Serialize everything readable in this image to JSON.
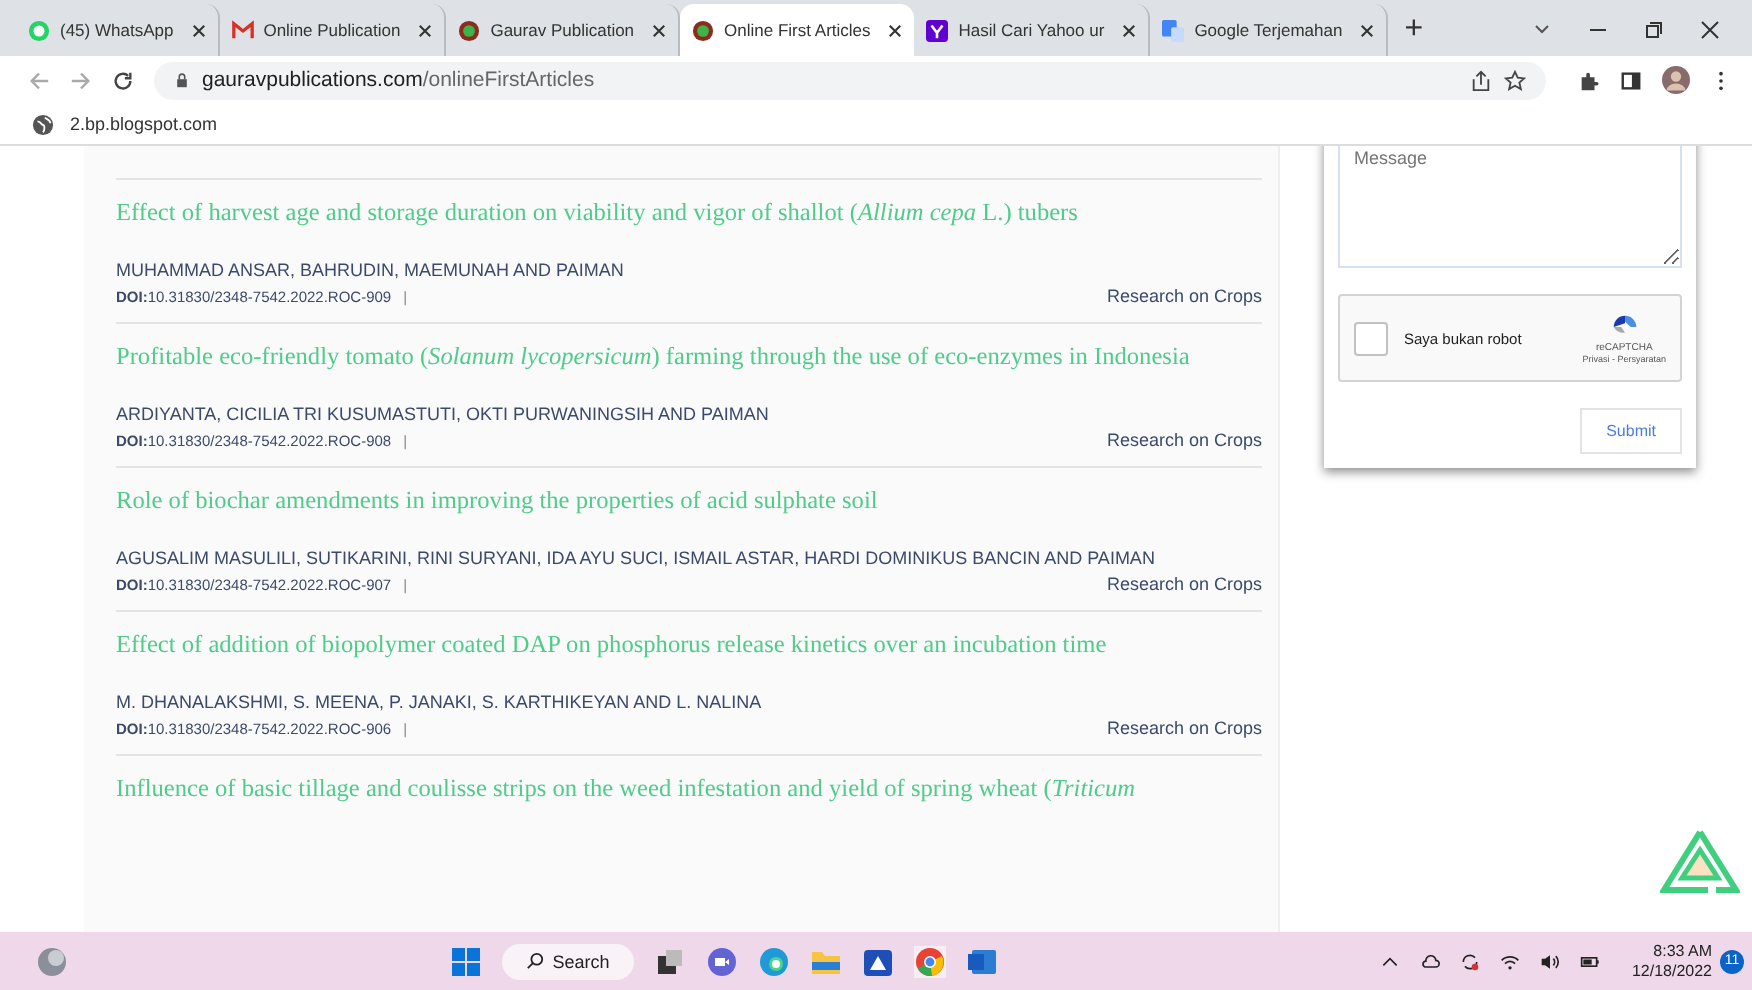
{
  "tabs": [
    {
      "title": "(45) WhatsApp",
      "kind": "chat",
      "selected": false
    },
    {
      "title": "Online Publication",
      "kind": "mail",
      "selected": false
    },
    {
      "title": "Gaurav Publication",
      "kind": "circle",
      "selected": false
    },
    {
      "title": "Online First Articles",
      "kind": "circle",
      "selected": true
    },
    {
      "title": "Hasil Cari Yahoo ur",
      "kind": "square",
      "selected": false
    },
    {
      "title": "Google Terjemahan",
      "kind": "translate",
      "selected": false
    }
  ],
  "new_tab": "+",
  "address": {
    "host": "gauravpublications.com",
    "path": "/onlineFirstArticles"
  },
  "status_link": "2.bp.blogspot.com",
  "articles": [
    {
      "title": "Effect of harvest age and storage duration on viability and vigor of shallot (*Allium cepa* L.) tubers",
      "authors": "MUHAMMAD ANSAR, BAHRUDIN, MAEMUNAH AND PAIMAN",
      "doi": "**DOI:**10.31830/2348-7542.2022.ROC-909",
      "separator": "|",
      "journal": "Research on Crops"
    },
    {
      "title": "Profitable eco-friendly tomato (*Solanum lycopersicum*) farming through the use of eco-enzymes in Indonesia",
      "authors": "ARDIYANTA, CICILIA TRI KUSUMASTUTI, OKTI PURWANINGSIH AND PAIMAN",
      "doi": "**DOI:**10.31830/2348-7542.2022.ROC-908",
      "separator": "|",
      "journal": "Research on Crops"
    },
    {
      "title": "Role of biochar amendments in improving the properties of acid sulphate soil",
      "authors": "AGUSALIM MASULILI, SUTIKARINI, RINI SURYANI, IDA AYU SUCI, ISMAIL ASTAR, HARDI DOMINIKUS BANCIN AND PAIMAN",
      "doi": "**DOI:**10.31830/2348-7542.2022.ROC-907",
      "separator": "|",
      "journal": "Research on Crops"
    },
    {
      "title": "Effect of addition of biopolymer coated DAP on phosphorus release kinetics over an incubation time",
      "authors": "M. DHANALAKSHMI, S. MEENA, P. JANAKI, S. KARTHIKEYAN AND L. NALINA",
      "doi": "**DOI:**10.31830/2348-7542.2022.ROC-906",
      "separator": "|",
      "journal": "Research on Crops"
    },
    {
      "title": "Influence of basic tillage and coulisse strips on the weed infestation and yield of spring wheat (*Triticum*"
    }
  ],
  "contact": {
    "message_placeholder": "Message",
    "captcha": {
      "checked": false,
      "label": "Saya bukan robot",
      "brand": "reCAPTCHA",
      "links": "Privasi - Persyaratan"
    },
    "submit": "Submit"
  },
  "taskbar": {
    "search": "Search",
    "time": "8:33 AM",
    "date": "12/18/2022",
    "notifications": "11"
  }
}
